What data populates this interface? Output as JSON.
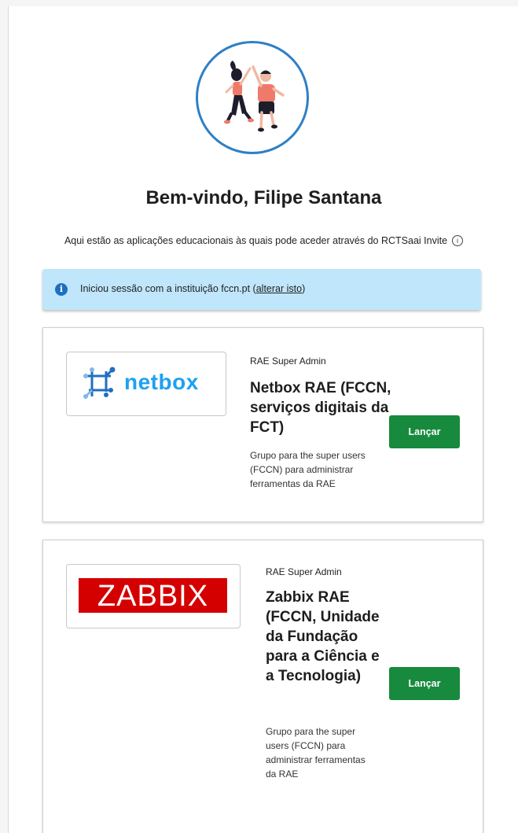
{
  "header": {
    "welcome": "Bem-vindo, Filipe Santana",
    "subtitle": "Aqui estão as aplicações educacionais às quais pode aceder através do RCTSaai Invite",
    "subtitle_info_icon": "info-circle-icon"
  },
  "notice": {
    "icon": "info-icon",
    "text_prefix": "Iniciou sessão com a instituição fccn.pt (",
    "link_label": "alterar isto",
    "text_suffix": ")"
  },
  "apps": [
    {
      "logo_text": "netbox",
      "role": "RAE Super Admin",
      "name": "Netbox RAE (FCCN, serviços digitais da FCT)",
      "description": "Grupo para the super users (FCCN) para administrar ferramentas da RAE",
      "button_label": "Lançar",
      "brand_color": "#1da1f2"
    },
    {
      "logo_text": "ZABBIX",
      "role": "RAE Super Admin",
      "name": "Zabbix RAE (FCCN, Unidade da Fundação para a Ciência e a Tecnologia)",
      "description": "Grupo para the super users (FCCN) para administrar ferramentas da RAE",
      "button_label": "Lançar",
      "brand_color": "#d40000"
    }
  ],
  "colors": {
    "accent_blue": "#2f7fc6",
    "notice_bg": "#bfe6fa",
    "button_green": "#178a3e"
  }
}
